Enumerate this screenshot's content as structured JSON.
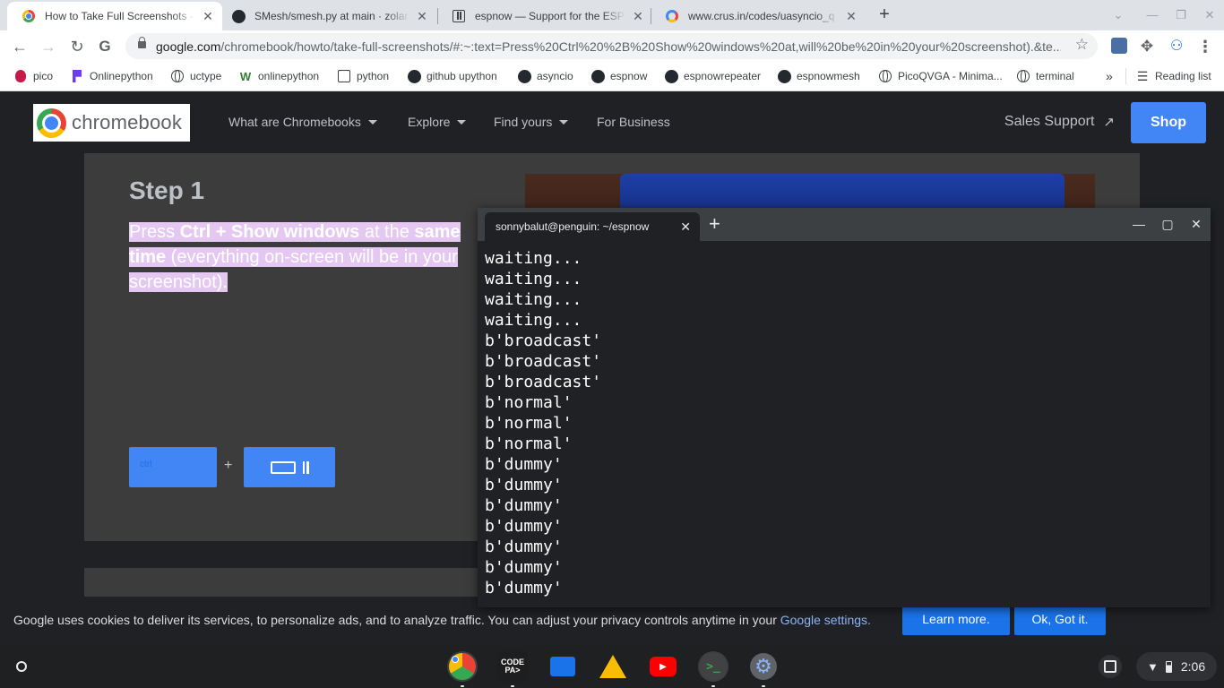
{
  "browser": {
    "tabs": [
      {
        "title": "How to Take Full Screenshots - G",
        "icon": "chrome-favicon",
        "active": true
      },
      {
        "title": "SMesh/smesh.py at main · zolar",
        "icon": "github-favicon",
        "active": false
      },
      {
        "title": "espnow — Support for the ESP-N",
        "icon": "docs-favicon",
        "active": false
      },
      {
        "title": "www.crus.in/codes/uasyncio_q",
        "icon": "crus-favicon",
        "active": false
      }
    ],
    "url_host": "google.com",
    "url_path": "/chromebook/howto/take-full-screenshots/#:~:text=Press%20Ctrl%20%2B%20Show%20windows%20at,will%20be%20in%20your%20screenshot).&te...",
    "bookmarks": [
      {
        "label": "pico",
        "icon": "raspberry-pi-icon"
      },
      {
        "label": "Onlinepython",
        "icon": "onlinepython-icon"
      },
      {
        "label": "uctype",
        "icon": "globe-icon"
      },
      {
        "label": "onlinepython",
        "icon": "w-icon"
      },
      {
        "label": "python",
        "icon": "doc-icon"
      },
      {
        "label": "github upython",
        "icon": "github-icon"
      },
      {
        "label": "asyncio",
        "icon": "github-icon"
      },
      {
        "label": "espnow",
        "icon": "github-icon"
      },
      {
        "label": "espnowrepeater",
        "icon": "github-icon"
      },
      {
        "label": "espnowmesh",
        "icon": "github-icon"
      },
      {
        "label": "PicoQVGA - Minima...",
        "icon": "globe-icon"
      },
      {
        "label": "terminal",
        "icon": "globe-icon"
      }
    ],
    "bookmarks_overflow": "»",
    "reading_list": "Reading list"
  },
  "site": {
    "logo_text": "chromebook",
    "nav": [
      "What are Chromebooks",
      "Explore",
      "Find yours",
      "For Business"
    ],
    "sales_support": "Sales Support",
    "shop": "Shop",
    "step_title": "Step 1",
    "step_text": {
      "press": "Press ",
      "keys": "Ctrl + Show windows",
      "at_the": " at the ",
      "same_time": "same time",
      "rest": " (everything on-screen will be in your screenshot)."
    },
    "key_ctrl": "ctrl",
    "key_plus": "+"
  },
  "cookie": {
    "text": "Google uses cookies to deliver its services, to personalize ads, and to analyze traffic. You can adjust your privacy controls anytime in your ",
    "link": "Google settings.",
    "learn_more": "Learn more.",
    "ok": "Ok, Got it."
  },
  "terminal": {
    "tab_title": "sonnybalut@penguin: ~/espnow",
    "lines": [
      "waiting...",
      "waiting...",
      "waiting...",
      "waiting...",
      "b'broadcast'",
      "b'broadcast'",
      "b'broadcast'",
      "b'normal'",
      "b'normal'",
      "b'normal'",
      "b'dummy'",
      "b'dummy'",
      "b'dummy'",
      "b'dummy'",
      "b'dummy'",
      "b'dummy'",
      "b'dummy'"
    ]
  },
  "shelf": {
    "apps": [
      "chrome-icon",
      "code-pad-icon",
      "files-icon",
      "drive-icon",
      "youtube-icon",
      "terminal-icon",
      "settings-icon"
    ],
    "code_pad_label": "CODE\nPA>",
    "time": "2:06"
  },
  "colors": {
    "accent": "#4285f4",
    "highlight": "#e4c8f2",
    "cookie_button": "#1a73e8"
  }
}
